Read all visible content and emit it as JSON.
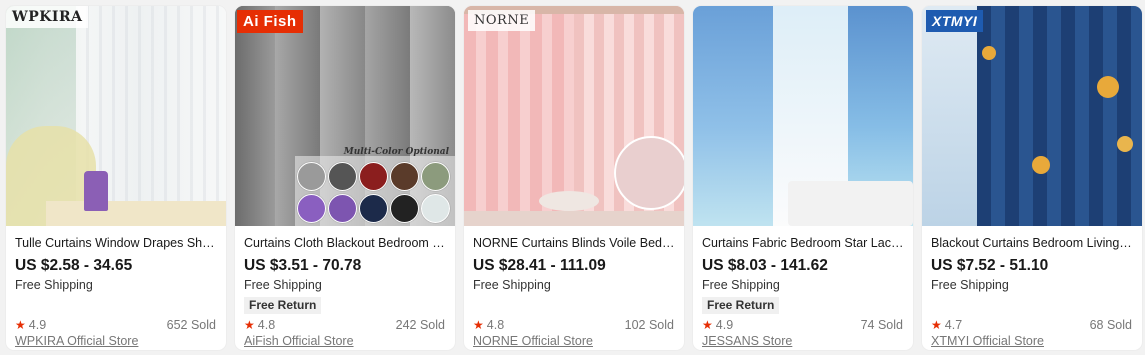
{
  "products": [
    {
      "brand": "WPKIRA",
      "title": "Tulle Curtains Window Drapes Sheer",
      "price": "US $2.58 - 34.65",
      "shipping": "Free Shipping",
      "free_return": "",
      "rating": "4.9",
      "sold": "652 Sold",
      "store": "WPKIRA Official Store"
    },
    {
      "brand": "Ai Fish",
      "overlay_text": "Multi-Color Optional",
      "title": "Curtains Cloth Blackout Bedroom Living",
      "price": "US $3.51 - 70.78",
      "shipping": "Free Shipping",
      "free_return": "Free Return",
      "rating": "4.8",
      "sold": "242 Sold",
      "store": "AiFish Official Store"
    },
    {
      "brand": "NORNE",
      "title": "NORNE Curtains Blinds Voile Bedroom",
      "price": "US $28.41 - 111.09",
      "shipping": "Free Shipping",
      "free_return": "",
      "rating": "4.8",
      "sold": "102 Sold",
      "store": "NORNE Official Store"
    },
    {
      "brand": "",
      "title": "Curtains Fabric Bedroom Star Lace Shade",
      "price": "US $8.03 - 141.62",
      "shipping": "Free Shipping",
      "free_return": "Free Return",
      "rating": "4.9",
      "sold": "74 Sold",
      "store": "JESSANS Store"
    },
    {
      "brand": "XTMYI",
      "title": "Blackout Curtains Bedroom Living-Room",
      "price": "US $7.52 - 51.10",
      "shipping": "Free Shipping",
      "free_return": "",
      "rating": "4.7",
      "sold": "68 Sold",
      "store": "XTMYI Official Store"
    }
  ],
  "colors": {
    "star": "#e62e04",
    "aifish_badge": "#e62e04",
    "xtmyi_badge": "#1e5bb0"
  }
}
